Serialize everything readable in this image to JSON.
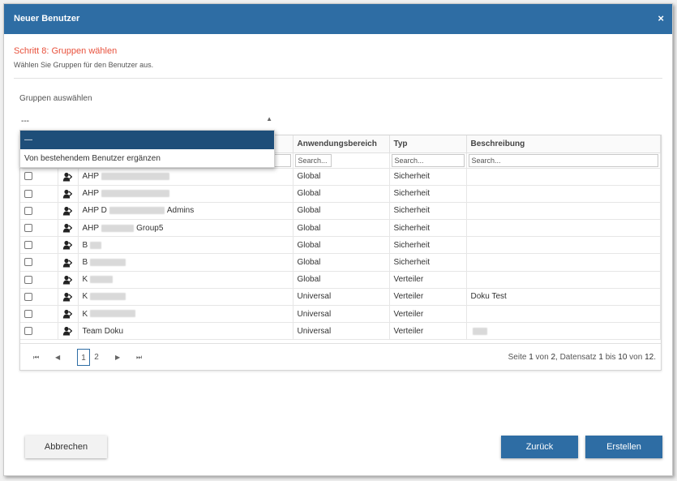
{
  "dialog": {
    "title": "Neuer Benutzer",
    "close": "×"
  },
  "step": {
    "title": "Schritt 8: Gruppen wählen",
    "subtitle": "Wählen Sie Gruppen für den Benutzer aus."
  },
  "group_select": {
    "label": "Gruppen auswählen",
    "value": "---",
    "options": [
      "—",
      "Von bestehendem Benutzer ergänzen"
    ]
  },
  "table": {
    "columns": [
      "Anwendungsbereich",
      "Typ",
      "Beschreibung"
    ],
    "filter_placeholder": "Search...",
    "rows": [
      {
        "name": "AHP",
        "scope": "Global",
        "type": "Sicherheit",
        "desc": ""
      },
      {
        "name": "AHP",
        "scope": "Global",
        "type": "Sicherheit",
        "desc": ""
      },
      {
        "name": "AHP D",
        "suffix": "Admins",
        "scope": "Global",
        "type": "Sicherheit",
        "desc": ""
      },
      {
        "name": "AHP",
        "suffix": "Group5",
        "scope": "Global",
        "type": "Sicherheit",
        "desc": ""
      },
      {
        "name": "B",
        "scope": "Global",
        "type": "Sicherheit",
        "desc": ""
      },
      {
        "name": "B",
        "scope": "Global",
        "type": "Sicherheit",
        "desc": ""
      },
      {
        "name": "K",
        "scope": "Global",
        "type": "Verteiler",
        "desc": ""
      },
      {
        "name": "K",
        "scope": "Universal",
        "type": "Verteiler",
        "desc": "Doku Test"
      },
      {
        "name": "K",
        "scope": "Universal",
        "type": "Verteiler",
        "desc": ""
      },
      {
        "name": "Team Doku",
        "scope": "Universal",
        "type": "Verteiler",
        "desc": ""
      }
    ]
  },
  "pager": {
    "first": "⏮",
    "prev": "◀",
    "next": "▶",
    "last": "⏭",
    "pages": [
      "1",
      "2"
    ],
    "info_prefix": "Seite ",
    "current_page": "1",
    "info_of": " von ",
    "total_pages": "2",
    "info_records": ", Datensatz ",
    "record_from": "1",
    "info_to": " bis ",
    "record_to": "10",
    "record_total": "12",
    "info_end": "."
  },
  "buttons": {
    "cancel": "Abbrechen",
    "back": "Zurück",
    "create": "Erstellen"
  },
  "colors": {
    "primary": "#2e6da4",
    "step_title": "#e8513c",
    "dropdown_selected": "#1e4e79"
  }
}
